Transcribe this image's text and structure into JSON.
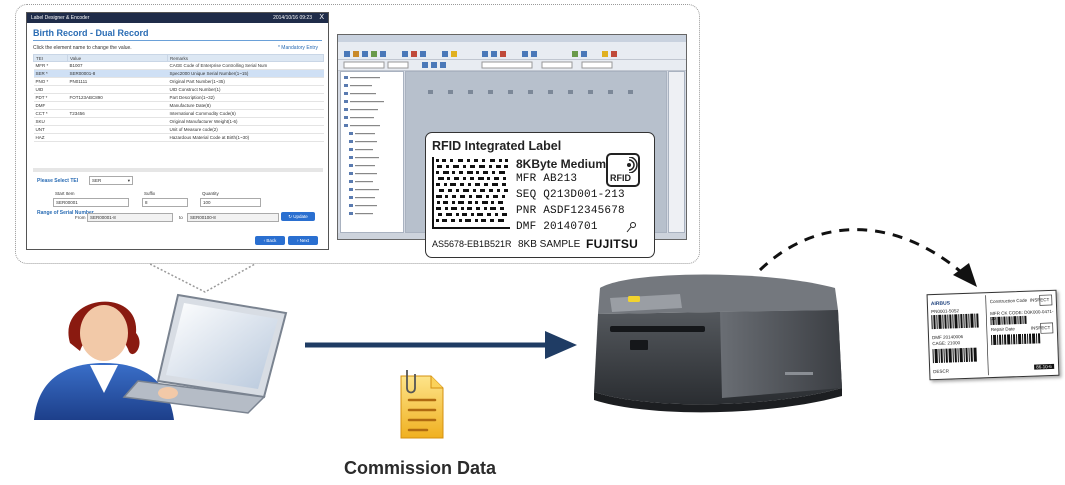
{
  "app_window": {
    "title": "Label Designer & Encoder",
    "datetime": "2014/10/16 09:23",
    "close": "X",
    "heading": "Birth Record - Dual Record",
    "instruction": "Click the element name to change the value.",
    "mandatory_note": "* Mandatory Entry",
    "columns": [
      "TEI",
      "Value",
      "Remarks"
    ],
    "rows": [
      {
        "tei": "MFR *",
        "value": "B1007",
        "remarks": "CAGE Code of Enterprise Controlling Serial Num"
      },
      {
        "tei": "SER *",
        "value": "SER00001-8",
        "remarks": "Spec2000 Unique Serial Number(1~15)"
      },
      {
        "tei": "PNO *",
        "value": "PN01111",
        "remarks": "Original Part Number(1~35)"
      },
      {
        "tei": "UID",
        "value": "",
        "remarks": "UID Construct Number(1)"
      },
      {
        "tei": "PDT *",
        "value": "FOT123ABC890",
        "remarks": "Part Description(1~32)"
      },
      {
        "tei": "DMF",
        "value": "",
        "remarks": "Manufacture Date(8)"
      },
      {
        "tei": "CCT *",
        "value": "T23456",
        "remarks": "International Commodity Code(6)"
      },
      {
        "tei": "SKU",
        "value": "",
        "remarks": "Original Manufacturer Weight(1-6)"
      },
      {
        "tei": "UNT",
        "value": "",
        "remarks": "Unit of Measure code(2)"
      },
      {
        "tei": "HAZ",
        "value": "",
        "remarks": "Hazardous Material Code at Birth(1~30)"
      }
    ],
    "select_tei_label": "Please Select TEI",
    "select_tei_value": "SER",
    "start_label": "Start Item",
    "start_value": "SER00001",
    "suffix_label": "Suffix",
    "suffix_value": "8",
    "quantity_label": "Quantity",
    "quantity_value": "100",
    "range_label": "Range of Serial Number",
    "range_from_label": "From",
    "range_from_value": "SER00001-8",
    "range_to_label": "to",
    "range_to_value": "SER00100-8",
    "update_button": "Update",
    "back_button": "Back",
    "next_button": "Next"
  },
  "designer_label": {
    "title": "RFID Integrated Label",
    "subtitle": "8KByte Medium",
    "rfid_badge": "RFID",
    "fields": [
      {
        "name": "MFR",
        "value": "AB213"
      },
      {
        "name": "SEQ",
        "value": "Q213D001-213"
      },
      {
        "name": "PNR",
        "value": "ASDF12345678"
      },
      {
        "name": "DMF",
        "value": "20140701"
      }
    ],
    "footer_code": "AS5678-EB1B521R",
    "footer_sample": "8KB SAMPLE",
    "brand": "FUJITSU"
  },
  "printed_tag": {
    "brand": "AIRBUS",
    "construction_code_label": "Construction Code",
    "inspect": "INSPECT",
    "inspect_2": "INSPECT",
    "part_no": "PN0001-5052",
    "mfr_code": "MFR CK CODE: D0K000-0471-00",
    "dmf": "DMF 20140006",
    "cage": "CAGE: 21000",
    "repair_date": "Repair Date",
    "desc": "DESCR",
    "tag": "86-10-6"
  },
  "caption": "Commission Data",
  "colors": {
    "arrow": "#1f3c64",
    "document": "#f7c43a",
    "accent": "#2a6cb4"
  }
}
